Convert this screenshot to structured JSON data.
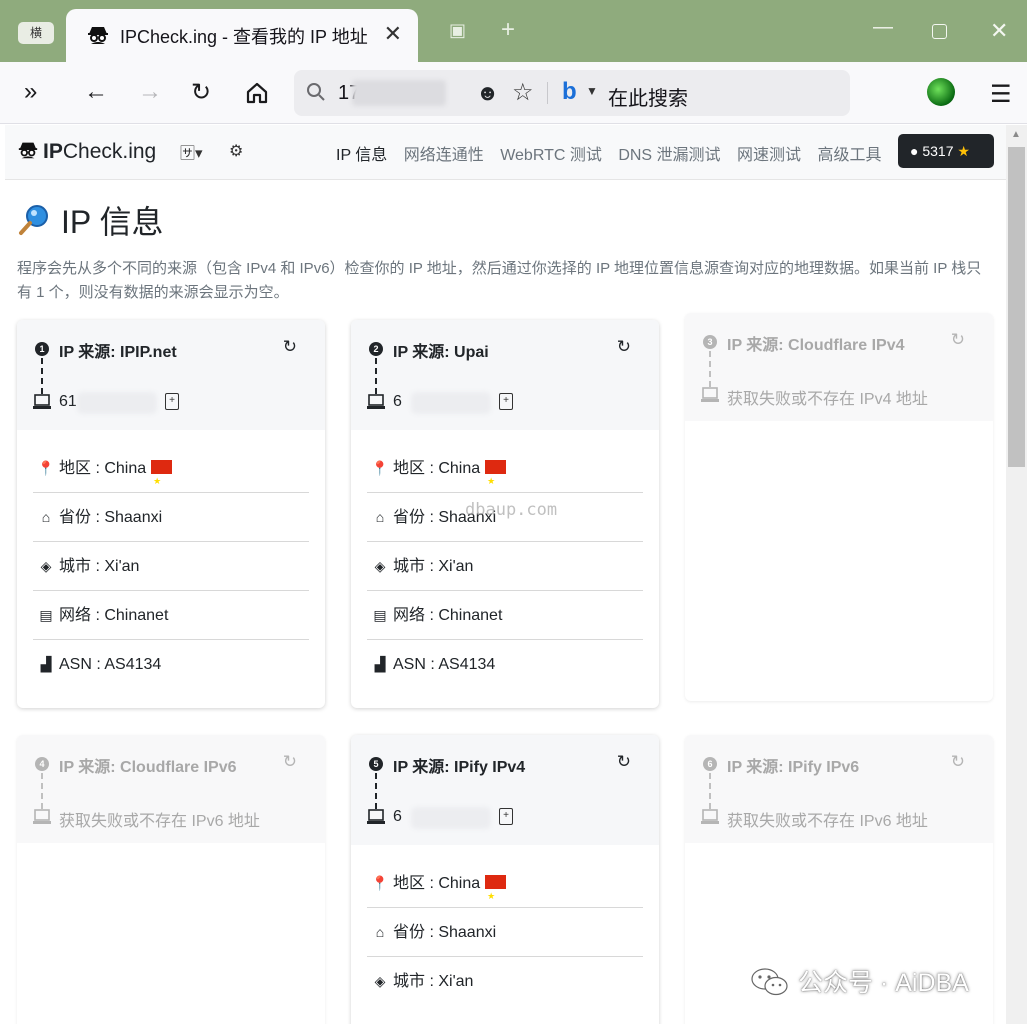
{
  "browser": {
    "mini_tab_label": "横",
    "tab_title": "IPCheck.ing - 查看我的 IP 地址",
    "url": "17",
    "search_placeholder": "在此搜索",
    "accent_color": "#8fab7d"
  },
  "site": {
    "brand_bold": "IP",
    "brand_rest": "Check.ing",
    "nav_links": [
      "IP 信息",
      "网络连通性",
      "WebRTC 测试",
      "DNS 泄漏测试",
      "网速测试",
      "高级工具"
    ],
    "github_stars": "5317",
    "page_title": "IP 信息",
    "description": "程序会先从多个不同的来源（包含 IPv4 和 IPv6）检查你的 IP 地址，然后通过你选择的 IP 地理位置信息源查询对应的地理数据。如果当前 IP 栈只有 1 个，则没有数据的来源会显示为空。"
  },
  "cards": [
    {
      "num": "1",
      "title": "IP 来源: IPIP.net",
      "ip": "61",
      "status": "ok",
      "rows": [
        {
          "icon": "location-pin-icon",
          "label": "地区 : China"
        },
        {
          "icon": "home-icon",
          "label": "省份 : Shaanxi"
        },
        {
          "icon": "signpost-icon",
          "label": "城市 : Xi'an"
        },
        {
          "icon": "router-icon",
          "label": "网络 : Chinanet"
        },
        {
          "icon": "bar-chart-icon",
          "label": "ASN : AS4134"
        }
      ]
    },
    {
      "num": "2",
      "title": "IP 来源: Upai",
      "ip": "6",
      "status": "ok",
      "rows": [
        {
          "icon": "location-pin-icon",
          "label": "地区 : China"
        },
        {
          "icon": "home-icon",
          "label": "省份 : Shaanxi"
        },
        {
          "icon": "signpost-icon",
          "label": "城市 : Xi'an"
        },
        {
          "icon": "router-icon",
          "label": "网络 : Chinanet"
        },
        {
          "icon": "bar-chart-icon",
          "label": "ASN : AS4134"
        }
      ]
    },
    {
      "num": "3",
      "title": "IP 来源: Cloudflare IPv4",
      "status": "fail",
      "fail_text": "获取失败或不存在 IPv4 地址"
    },
    {
      "num": "4",
      "title": "IP 来源: Cloudflare IPv6",
      "status": "fail",
      "fail_text": "获取失败或不存在 IPv6 地址"
    },
    {
      "num": "5",
      "title": "IP 来源: IPify IPv4",
      "ip": "6",
      "status": "ok",
      "rows": [
        {
          "icon": "location-pin-icon",
          "label": "地区 : China"
        },
        {
          "icon": "home-icon",
          "label": "省份 : Shaanxi"
        },
        {
          "icon": "signpost-icon",
          "label": "城市 : Xi'an"
        }
      ]
    },
    {
      "num": "6",
      "title": "IP 来源: IPify IPv6",
      "status": "fail",
      "fail_text": "获取失败或不存在 IPv6 地址"
    }
  ],
  "watermark": "dbaup.com",
  "wechat_label": "公众号 · AiDBA"
}
